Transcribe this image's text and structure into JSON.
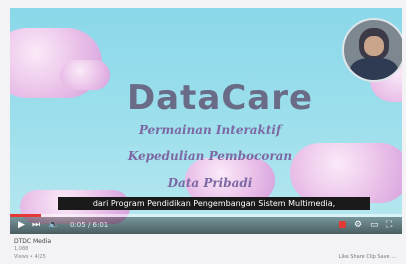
{
  "video": {
    "title_main": "DataCare",
    "line1": "Permainan Interaktif",
    "line2": "Kepedulian Pembocoran",
    "line3": "Data Pribadi",
    "caption": "dari Program Pendidikan Pengembangan Sistem Multimedia,",
    "progress_fraction": 0.08,
    "time_display": "0:05 / 6:01"
  },
  "below": {
    "channel": "DTDC Media",
    "subscribers": "1,088",
    "views": "Views • 4/25",
    "actions": "Like  Share  Clip  Save  ..."
  },
  "icons": {
    "play": "play-icon",
    "next": "next-icon",
    "volume": "volume-icon",
    "settings": "gear-icon",
    "fullscreen": "fullscreen-icon"
  },
  "colors": {
    "sky": "#8ad8ea",
    "title": "#6a6b86",
    "subtitle": "#7c68a3",
    "progress": "#e53935"
  }
}
